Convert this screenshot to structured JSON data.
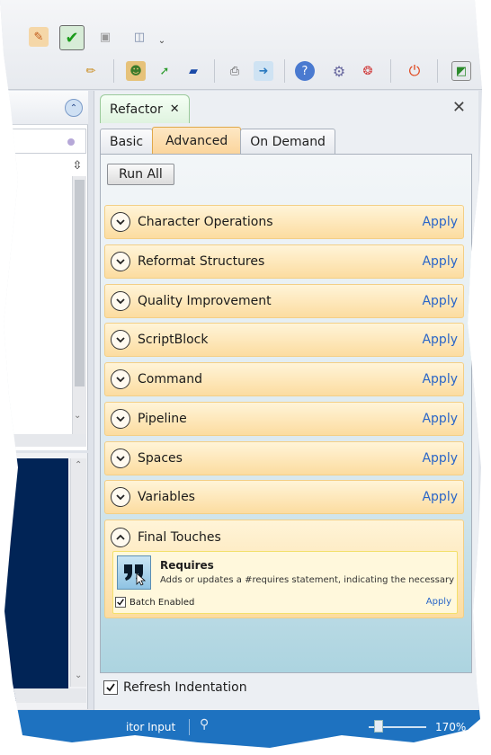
{
  "panel": {
    "tab_label": "Refactor",
    "close_glyph": "✕",
    "tabs": [
      "Basic",
      "Advanced",
      "On Demand"
    ],
    "run_all_label": "Run All",
    "groups": [
      {
        "title": "Character Operations",
        "apply": "Apply"
      },
      {
        "title": "Reformat Structures",
        "apply": "Apply"
      },
      {
        "title": "Quality Improvement",
        "apply": "Apply"
      },
      {
        "title": "ScriptBlock",
        "apply": "Apply"
      },
      {
        "title": "Command",
        "apply": "Apply"
      },
      {
        "title": "Pipeline",
        "apply": "Apply"
      },
      {
        "title": "Spaces",
        "apply": "Apply"
      },
      {
        "title": "Variables",
        "apply": "Apply"
      }
    ],
    "final_group": {
      "title": "Final Touches",
      "rule": {
        "title": "Requires",
        "description": "Adds or updates a #requires statement, indicating the necessary",
        "batch_label": "Batch Enabled",
        "batch_checked": true,
        "apply": "Apply"
      }
    },
    "refresh_label": "Refresh Indentation",
    "refresh_checked": true
  },
  "statusbar": {
    "input_label": "itor Input",
    "zoom": "170%"
  },
  "colors": {
    "accent_apply": "#2a66c8",
    "group_bg": "#fcdca0",
    "statusbar": "#1e72c0",
    "console_bg": "#012456"
  }
}
